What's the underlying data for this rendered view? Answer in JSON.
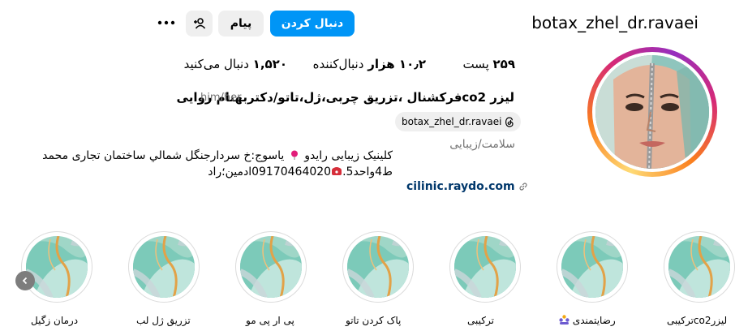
{
  "profile": {
    "username": "botax_zhel_dr.ravaei",
    "follow_label": "دنبال کردن",
    "message_label": "پیام",
    "suggest_icon": "add-person-icon",
    "more_icon": "more-horizontal-icon",
    "colors": {
      "accent": "#0095f6",
      "link": "#00376b",
      "muted": "#737373"
    }
  },
  "stats": {
    "posts": {
      "value": "۲۵۹",
      "label": "پست"
    },
    "followers": {
      "value": "۱۰٫۲ هزار",
      "label": "دنبال‌کننده"
    },
    "following": {
      "value": "۱,۵۲۰",
      "label": "دنبال می‌کنید"
    }
  },
  "bio": {
    "full_name": "لیزر co2فرکشنال ،تزریق چربی،ژل،تاتو/دکتربهنام روایی",
    "pronouns": "him/her",
    "threads_handle": "botax_zhel_dr.ravaei",
    "category": "سلامت/زیبایی",
    "line1_text": "کلینیک زیبایی رایدو",
    "line1_rest": "یاسوج:خ سردارجنگل شمالي ساختمان تجاری محمد",
    "line2_start": "ط4واحد5.",
    "line2_rest": "09170464020ادمین؛راد",
    "link": "cilinic.raydo.com"
  },
  "highlights": [
    {
      "label": "لیزرco2ترکیبی"
    },
    {
      "label": "رضایتمندی"
    },
    {
      "label": "ترکیبی"
    },
    {
      "label": "پاک کردن تاتو"
    },
    {
      "label": "پی ار پی مو"
    },
    {
      "label": "تزریق ژل لب"
    },
    {
      "label": "درمان زگیل"
    }
  ]
}
